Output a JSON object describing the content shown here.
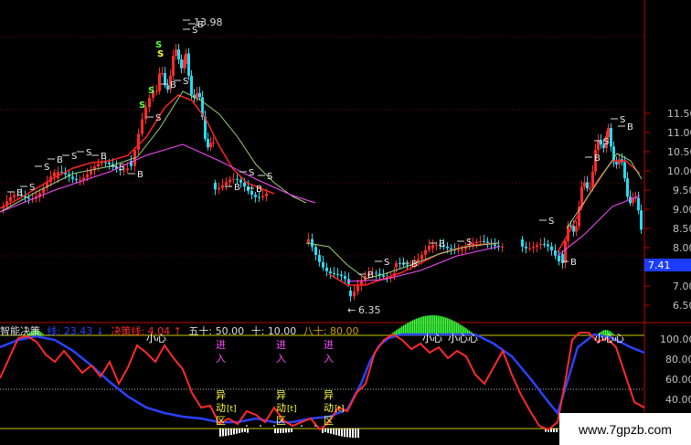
{
  "colors": {
    "up": "#ff2a2a",
    "down": "#29d9f0",
    "ma_red": "#ff2222",
    "ma_green": "#9ad27a",
    "ma_magenta": "#ff4cff",
    "axis": "#c00000",
    "price_tag_bg": "#1c3cff",
    "signal_s": "#ffffff",
    "signal_b": "#ffffff",
    "s_yellow": "#ffff33",
    "s_green": "#5bff3b",
    "grid": "#800000",
    "osc_red": "#ff2a2a",
    "osc_blue": "#2a42ff",
    "osc_green": "#3cff3c",
    "osc_yellow": "#c8c800",
    "osc_dot": "#c0c0c0"
  },
  "price_axis": {
    "labels": [
      "11.50",
      "11.00",
      "10.50",
      "10.00",
      "9.50",
      "9.00",
      "8.50",
      "8.00",
      "7.50",
      "7.00",
      "6.50"
    ],
    "current_price": "7.41"
  },
  "annotations": {
    "high_label": "13.98",
    "low_label": "6.35",
    "arrow_left": "←",
    "s_mark": "S",
    "b_mark": "B"
  },
  "indicator": {
    "name": "智能决策",
    "t1_label": "线:",
    "t1_value": "23.43",
    "t1_arrow": "↓",
    "t2_label": "决策线:",
    "t2_value": "4.04",
    "t2_arrow": "↑",
    "t3_label": "五十:",
    "t3_value": "50.00",
    "t4_label": "十:",
    "t4_value": "10.00",
    "t5_label": "八十:",
    "t5_value": "80.00"
  },
  "osc_axis": {
    "labels": [
      "100.00",
      "80.00",
      "60.00",
      "40.00"
    ]
  },
  "osc_annotations": {
    "xiaoxin": "小心",
    "xiaoxin2": "小心心",
    "jin": "进",
    "ru": "入",
    "yi": "异",
    "dong": "动",
    "bracket": "[t]",
    "qu": "区"
  },
  "watermark": "www.7gpzb.com"
}
